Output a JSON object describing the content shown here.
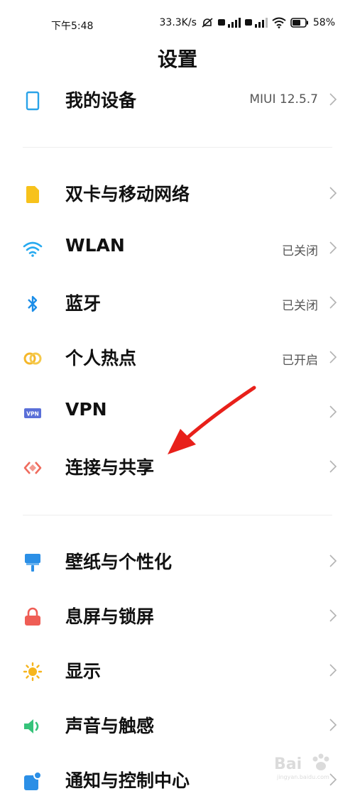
{
  "status_bar": {
    "time": "下午5:48",
    "net_speed": "33.3K/s",
    "battery": "58%"
  },
  "title": "设置",
  "device": {
    "label": "我的设备",
    "value": "MIUI 12.5.7",
    "icon": "phone-icon",
    "color": "#2aa3e8"
  },
  "network_items": [
    {
      "label": "双卡与移动网络",
      "value": "",
      "icon": "sim-card-icon",
      "color": "#f7c21b"
    },
    {
      "label": "WLAN",
      "value": "已关闭",
      "icon": "wifi-icon",
      "color": "#27aaf0"
    },
    {
      "label": "蓝牙",
      "value": "已关闭",
      "icon": "bluetooth-icon",
      "color": "#1c8ee8"
    },
    {
      "label": "个人热点",
      "value": "已开启",
      "icon": "hotspot-icon",
      "color": "#f5b72b"
    },
    {
      "label": "VPN",
      "value": "",
      "icon": "vpn-icon",
      "color": "#5a6fd8"
    },
    {
      "label": "连接与共享",
      "value": "",
      "icon": "connection-sharing-icon",
      "color": "#ef6b5d"
    }
  ],
  "display_items": [
    {
      "label": "壁纸与个性化",
      "value": "",
      "icon": "wallpaper-icon",
      "color": "#2b8fe6"
    },
    {
      "label": "息屏与锁屏",
      "value": "",
      "icon": "lock-icon",
      "color": "#ef5d55"
    },
    {
      "label": "显示",
      "value": "",
      "icon": "brightness-icon",
      "color": "#f6b51d"
    },
    {
      "label": "声音与触感",
      "value": "",
      "icon": "speaker-icon",
      "color": "#36c37a"
    },
    {
      "label": "通知与控制中心",
      "value": "",
      "icon": "notification-icon",
      "color": "#2b8fe6"
    }
  ],
  "watermark": {
    "brand": "Bai",
    "sub": "jingyan.baidu.com"
  }
}
